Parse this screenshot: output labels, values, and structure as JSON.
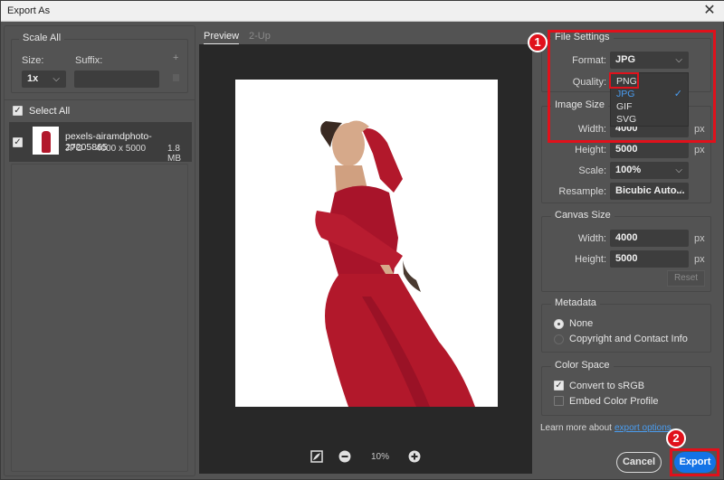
{
  "window": {
    "title": "Export As",
    "close_icon": "close-icon"
  },
  "left": {
    "scale_all": {
      "legend": "Scale All",
      "size_label": "Size:",
      "suffix_label": "Suffix:",
      "size_value": "1x",
      "suffix_value": "",
      "add_icon": "+",
      "trash_icon": "trash-icon"
    },
    "select_all": {
      "label": "Select All",
      "checked": true
    },
    "files": [
      {
        "name": "pexels-airamdphoto-27205865",
        "format": "JPG",
        "dimensions": "4000 x 5000",
        "size": "1.8 MB",
        "checked": true
      }
    ]
  },
  "center": {
    "tabs": [
      {
        "label": "Preview",
        "active": true
      },
      {
        "label": "2-Up",
        "active": false
      }
    ],
    "zoom_level": "10%"
  },
  "right": {
    "file_settings": {
      "legend": "File Settings",
      "format_label": "Format:",
      "format_value": "JPG",
      "quality_label": "Quality:",
      "dropdown_options": [
        {
          "label": "PNG",
          "selected": false
        },
        {
          "label": "JPG",
          "selected": true
        },
        {
          "label": "GIF",
          "selected": false
        },
        {
          "label": "SVG",
          "selected": false
        }
      ]
    },
    "image_size": {
      "legend": "Image Size",
      "width_label": "Width:",
      "width_value": "4000",
      "height_label": "Height:",
      "height_value": "5000",
      "scale_label": "Scale:",
      "scale_value": "100%",
      "resample_label": "Resample:",
      "resample_value": "Bicubic Auto...",
      "unit": "px"
    },
    "canvas_size": {
      "legend": "Canvas Size",
      "width_label": "Width:",
      "width_value": "4000",
      "height_label": "Height:",
      "height_value": "5000",
      "unit": "px",
      "reset_label": "Reset"
    },
    "metadata": {
      "legend": "Metadata",
      "options": [
        {
          "label": "None",
          "selected": true
        },
        {
          "label": "Copyright and Contact Info",
          "selected": false
        }
      ]
    },
    "color_space": {
      "legend": "Color Space",
      "convert_label": "Convert to sRGB",
      "convert_checked": true,
      "embed_label": "Embed Color Profile",
      "embed_checked": false
    },
    "learn_more_text": "Learn more about",
    "learn_more_link": "export options.",
    "cancel_label": "Cancel",
    "export_label": "Export"
  },
  "annotations": {
    "badge_1": "1",
    "badge_2": "2",
    "highlight_color": "#e0111b"
  },
  "colors": {
    "accent": "#1473e6",
    "panel_bg": "#535353",
    "preview_bg": "#282828",
    "dress": "#b2182b"
  }
}
